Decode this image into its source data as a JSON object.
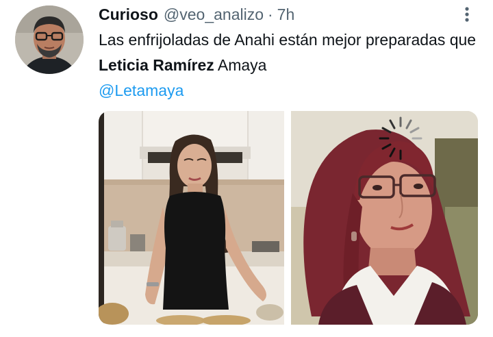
{
  "author": {
    "display_name": "Curioso",
    "handle": "@veo_analizo",
    "separator": "·",
    "timestamp": "7h"
  },
  "tweet": {
    "text_part1": "Las enfrijoladas de Anahi están mejor preparadas que ",
    "text_bold": "Leticia Ramírez",
    "text_part2": " Amaya",
    "mention": "@Letamaya"
  },
  "media": [
    {
      "icon": "photo-woman-kitchen"
    },
    {
      "icon": "photo-woman-glasses"
    }
  ],
  "icons": {
    "more": "more-vertical-icon",
    "loading": "loading-spinner-icon"
  },
  "colors": {
    "name": "#0f1419",
    "secondary": "#536471",
    "link": "#1d9bf0"
  }
}
